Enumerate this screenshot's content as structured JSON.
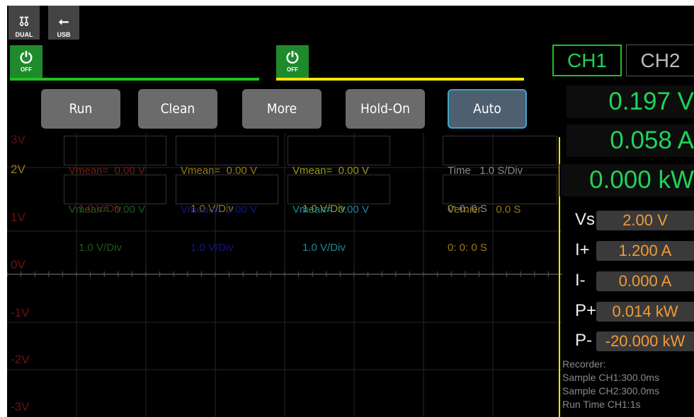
{
  "status_icons": [
    {
      "label": "DUAL",
      "icon": "dual-output-icon"
    },
    {
      "label": "USB",
      "icon": "usb-icon"
    }
  ],
  "outputs": [
    {
      "state": "OFF",
      "bar_color": "#1ec21e"
    },
    {
      "state": "OFF",
      "bar_color": "#f5e600"
    }
  ],
  "toolbar": {
    "run": "Run",
    "clean": "Clean",
    "more": "More",
    "hold_on": "Hold-On",
    "auto": "Auto"
  },
  "measure": {
    "m1": {
      "l1": "Vmean=  0.00 V",
      "l2": "1.0 V/Div",
      "color": "#7a1a14"
    },
    "m2": {
      "l1": "Vmean=  0.00 V",
      "l2": "1.0 V/Div",
      "color": "#9a7a18"
    },
    "m3": {
      "l1": "Vmean=  0.00 V",
      "l2": "1.0 V/Div",
      "color": "#9a9a18"
    },
    "m4": {
      "l1": "Time   1.0 S/Div",
      "l2": "0: 0: 0 S",
      "color": "#8a8a8a"
    },
    "m5": {
      "l1": "Vmean=  0.00 V",
      "l2": "1.0 V/Div",
      "color": "#1a5a1a"
    },
    "m6": {
      "l1": "Vmean=  0.00 V",
      "l2": "1.0 V/Div",
      "color": "#14148a"
    },
    "m7": {
      "l1": "Vmean=  0.00 V",
      "l2": "1.0 V/Div",
      "color": "#1a8a9a"
    },
    "m8": {
      "l1": "Vernier     0.0 S",
      "l2": "0: 0: 0 S",
      "color": "#9a7a18"
    }
  },
  "y_labels": [
    "3V",
    "2V",
    "1V",
    "0V",
    "-1V",
    "-2V",
    "-3V"
  ],
  "channels": {
    "ch1": "CH1",
    "ch2": "CH2",
    "active": "CH1"
  },
  "readings": {
    "voltage": "0.197 V",
    "current": "0.058 A",
    "power": "0.000 kW"
  },
  "settings": [
    {
      "label": "Vs",
      "value": "2.00 V"
    },
    {
      "label": "I+",
      "value": "1.200 A"
    },
    {
      "label": "I-",
      "value": "0.000 A"
    },
    {
      "label": "P+",
      "value": "0.014 kW"
    },
    {
      "label": "P-",
      "value": "-20.000 kW"
    }
  ],
  "recorder": {
    "title": "Recorder:",
    "sample_ch1": "Sample CH1:300.0ms",
    "sample_ch2": "Sample CH2:300.0ms",
    "run_time_ch1": "Run Time CH1:1s"
  }
}
